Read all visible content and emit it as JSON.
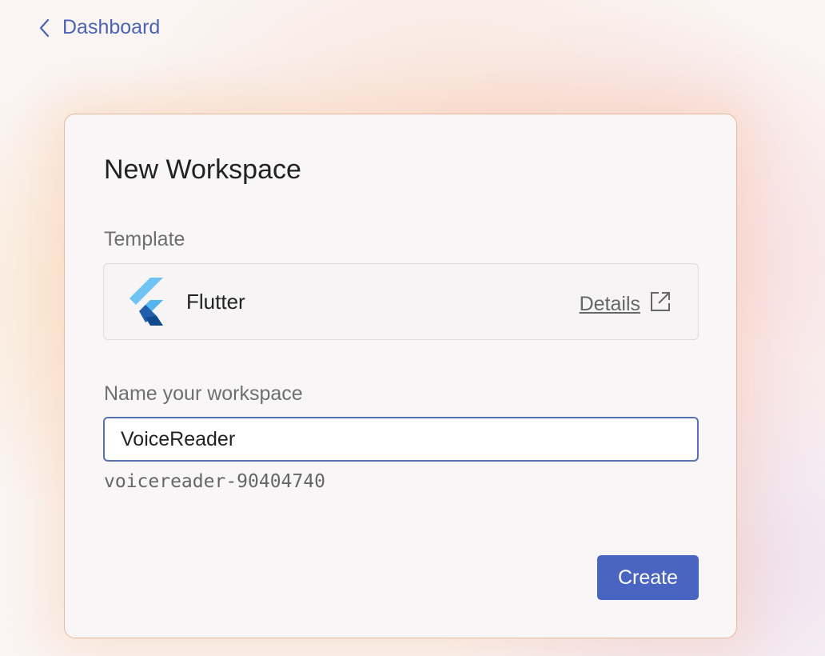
{
  "nav": {
    "back_label": "Dashboard",
    "back_icon": "chevron-left-icon"
  },
  "card": {
    "title": "New Workspace",
    "template_section": {
      "label": "Template",
      "selected_template": "Flutter",
      "template_icon": "flutter-logo",
      "details_label": "Details",
      "details_icon": "external-link-icon"
    },
    "name_section": {
      "label": "Name your workspace",
      "input_value": "VoiceReader",
      "slug": "voicereader-90404740"
    },
    "create_label": "Create"
  },
  "colors": {
    "accent": "#4a64c2",
    "link": "#4a64b3",
    "input_border": "#5771b7"
  }
}
